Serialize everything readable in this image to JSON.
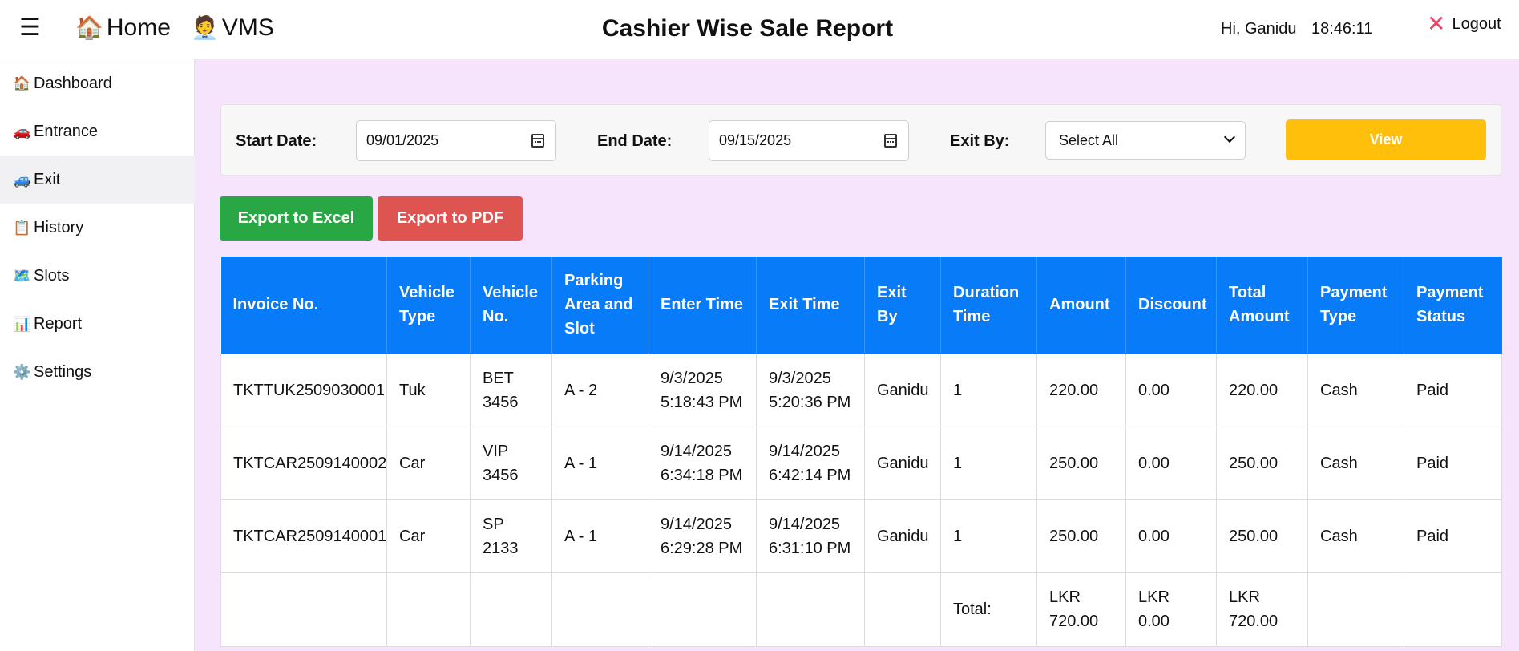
{
  "topbar": {
    "menu_icon": "hamburger-icon",
    "home_emoji": "🏠",
    "home_label": "Home",
    "vms_emoji": "🧑‍💼",
    "vms_label": "VMS",
    "title": "Cashier Wise Sale Report",
    "greeting": "Hi, Ganidu",
    "time": "18:46:11",
    "logout_icon": "close-icon",
    "logout_label": "Logout"
  },
  "sidebar": {
    "items": [
      {
        "emoji": "🏠",
        "label": "Dashboard"
      },
      {
        "emoji": "🚗",
        "label": "Entrance"
      },
      {
        "emoji": "🚙",
        "label": "Exit"
      },
      {
        "emoji": "📋",
        "label": "History"
      },
      {
        "emoji": "🗺️",
        "label": "Slots"
      },
      {
        "emoji": "📊",
        "label": "Report"
      },
      {
        "emoji": "⚙️",
        "label": "Settings"
      }
    ],
    "active": "Exit"
  },
  "filter": {
    "start_label": "Start Date:",
    "start_value": "09/01/2025",
    "end_label": "End Date:",
    "end_value": "09/15/2025",
    "exit_label": "Exit By:",
    "exit_selected": "Select All",
    "view_label": "View"
  },
  "actions": {
    "excel_label": "Export to Excel",
    "pdf_label": "Export to PDF"
  },
  "table": {
    "headers": [
      "Invoice No.",
      "Vehicle Type",
      "Vehicle No.",
      "Parking Area and Slot",
      "Enter Time",
      "Exit Time",
      "Exit By",
      "Duration Time",
      "Amount",
      "Discount",
      "Total Amount",
      "Payment Type",
      "Payment Status"
    ],
    "rows": [
      [
        "TKTTUK2509030001",
        "Tuk",
        "BET 3456",
        "A - 2",
        "9/3/2025 5:18:43 PM",
        "9/3/2025 5:20:36 PM",
        "Ganidu",
        "1",
        "220.00",
        "0.00",
        "220.00",
        "Cash",
        "Paid"
      ],
      [
        "TKTCAR2509140002",
        "Car",
        "VIP 3456",
        "A - 1",
        "9/14/2025 6:34:18 PM",
        "9/14/2025 6:42:14 PM",
        "Ganidu",
        "1",
        "250.00",
        "0.00",
        "250.00",
        "Cash",
        "Paid"
      ],
      [
        "TKTCAR2509140001",
        "Car",
        "SP 2133",
        "A - 1",
        "9/14/2025 6:29:28 PM",
        "9/14/2025 6:31:10 PM",
        "Ganidu",
        "1",
        "250.00",
        "0.00",
        "250.00",
        "Cash",
        "Paid"
      ]
    ],
    "total_label": "Total:",
    "total_amount": "LKR 720.00",
    "total_discount": "LKR 0.00",
    "total_total": "LKR 720.00"
  },
  "colors": {
    "header_blue": "#087bf8",
    "view_yellow": "#ffbf0a",
    "excel_green": "#2aa745",
    "pdf_red": "#de5450",
    "page_bg": "#f5e4fb"
  }
}
